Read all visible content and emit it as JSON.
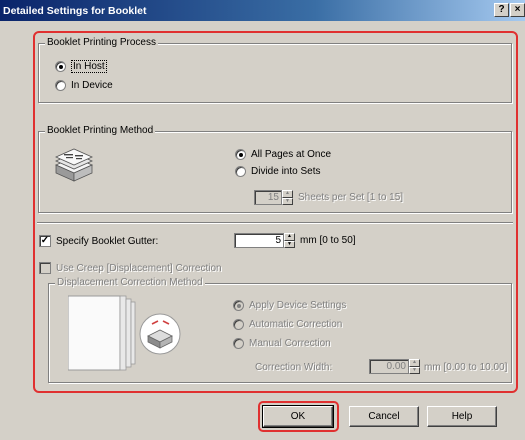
{
  "window": {
    "title": "Detailed Settings for Booklet",
    "help_glyph": "?",
    "close_glyph": "×"
  },
  "process": {
    "label": "Booklet Printing Process",
    "options": [
      "In Host",
      "In Device"
    ],
    "selected": "In Host"
  },
  "method": {
    "label": "Booklet Printing Method",
    "options": [
      "All Pages at Once",
      "Divide into Sets"
    ],
    "selected": "All Pages at Once",
    "sheets_value": "15",
    "sheets_label": "Sheets per Set [1 to 15]"
  },
  "gutter": {
    "label": "Specify Booklet Gutter:",
    "checked": true,
    "value": "5",
    "range_label": "mm [0 to 50]"
  },
  "creep": {
    "label": "Use Creep [Displacement] Correction",
    "checked": false
  },
  "displacement": {
    "label": "Displacement Correction Method",
    "options": [
      "Apply Device Settings",
      "Automatic Correction",
      "Manual Correction"
    ],
    "selected": "Apply Device Settings",
    "width_label": "Correction Width:",
    "width_value": "0.00",
    "width_range": "mm [0.00 to 10.00]"
  },
  "buttons": {
    "ok": "OK",
    "cancel": "Cancel",
    "help": "Help"
  },
  "colors": {
    "highlight": "#e03030",
    "title_bar": "#0a246a",
    "dialog_bg": "#d4d0c8"
  }
}
